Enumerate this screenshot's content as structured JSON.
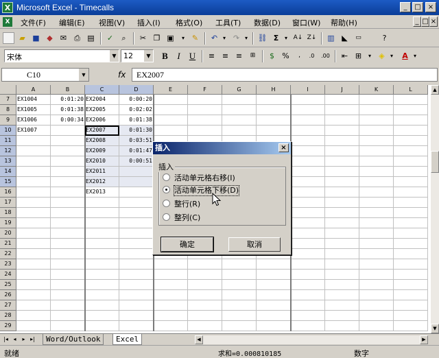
{
  "window": {
    "title": "Microsoft Excel - Timecalls",
    "buttons": {
      "min": "_",
      "max": "□",
      "close": "×"
    }
  },
  "menu": [
    "文件(F)",
    "编辑(E)",
    "视图(V)",
    "插入(I)",
    "格式(O)",
    "工具(T)",
    "数据(D)",
    "窗口(W)",
    "帮助(H)"
  ],
  "toolbar": {
    "font": "宋体",
    "size": "12",
    "bold": "B",
    "italic": "I",
    "underline": "U",
    "sum": "Σ",
    "percent": "%"
  },
  "formula_bar": {
    "name_box": "C10",
    "fx": "fx",
    "value": "EX2007"
  },
  "columns": [
    "A",
    "B",
    "C",
    "D",
    "E",
    "F",
    "G",
    "H",
    "I",
    "J",
    "K",
    "L"
  ],
  "rows": [
    "7",
    "8",
    "9",
    "10",
    "11",
    "12",
    "13",
    "14",
    "15",
    "16",
    "17",
    "18",
    "19",
    "20",
    "21",
    "22",
    "23",
    "24",
    "25",
    "26",
    "27",
    "28",
    "29"
  ],
  "cells": {
    "A": [
      "EX1004",
      "EX1005",
      "EX1006",
      "EX1007"
    ],
    "B": [
      "0:01:20",
      "0:01:38",
      "0:00:34",
      ""
    ],
    "C": [
      "EX2004",
      "EX2005",
      "EX2006",
      "EX2007",
      "EX2008",
      "EX2009",
      "EX2010",
      "EX2011",
      "EX2012",
      "EX2013"
    ],
    "D": [
      "0:00:20",
      "0:02:02",
      "0:01:38",
      "0:01:30",
      "0:03:51",
      "0:01:47",
      "0:00:51"
    ]
  },
  "dialog": {
    "title": "插入",
    "close": "×",
    "group_label": "插入",
    "options": [
      "活动单元格右移(I)",
      "活动单元格下移(D)",
      "整行(R)",
      "整列(C)"
    ],
    "selected_index": 1,
    "ok": "确定",
    "cancel": "取消"
  },
  "sheet_tabs": [
    "Word/Outlook",
    "Excel"
  ],
  "active_tab": "Excel",
  "status": {
    "left": "就绪",
    "sum": "求和=0.000810185",
    "mode": "数字"
  },
  "colors": {
    "title_bar": "#0a3d98",
    "selection": "#b8c4de",
    "face": "#d4d0c8"
  }
}
